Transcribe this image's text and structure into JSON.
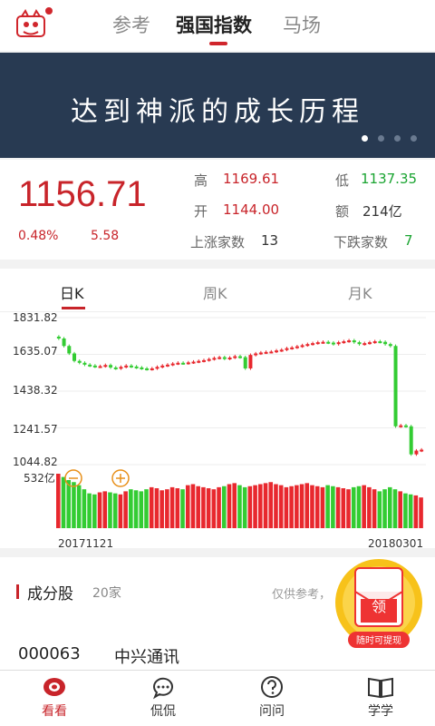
{
  "topnav": {
    "tabs": [
      {
        "label": "参考"
      },
      {
        "label": "强国指数"
      },
      {
        "label": "马场"
      }
    ],
    "active": "强国指数"
  },
  "banner": {
    "text": "达到神派的成长历程",
    "pages": 4,
    "current": 1
  },
  "quote": {
    "price": "1156.71",
    "change_pct": "0.48%",
    "change_abs": "5.58",
    "high_label": "高",
    "high": "1169.61",
    "low_label": "低",
    "low": "1137.35",
    "open_label": "开",
    "open": "1144.00",
    "amount_label": "额",
    "amount": "214亿",
    "up_label": "上涨家数",
    "up": "13",
    "down_label": "下跌家数",
    "down": "7"
  },
  "kline_tabs": [
    {
      "label": "日K"
    },
    {
      "label": "周K"
    },
    {
      "label": "月K"
    }
  ],
  "chart": {
    "y_ticks": [
      "1831.82",
      "1635.07",
      "1438.32",
      "1241.57",
      "1044.82"
    ],
    "volume_label": "532亿",
    "start_date": "20171121",
    "end_date": "20180301",
    "colors": {
      "up": "#e8282e",
      "down": "#33cc33"
    }
  },
  "chart_data": {
    "type": "candlestick",
    "y_ticks": [
      1831.82,
      1635.07,
      1438.32,
      1241.57,
      1044.82
    ],
    "ylim": [
      1044.82,
      1831.82
    ],
    "x_range": [
      "20171121",
      "20180301"
    ],
    "close": [
      1720,
      1680,
      1640,
      1600,
      1590,
      1580,
      1575,
      1570,
      1572,
      1578,
      1565,
      1560,
      1568,
      1575,
      1570,
      1565,
      1560,
      1556,
      1560,
      1568,
      1575,
      1580,
      1586,
      1590,
      1588,
      1592,
      1596,
      1600,
      1604,
      1610,
      1616,
      1620,
      1612,
      1618,
      1625,
      1620,
      1560,
      1632,
      1640,
      1645,
      1648,
      1650,
      1656,
      1660,
      1668,
      1672,
      1678,
      1684,
      1690,
      1695,
      1700,
      1702,
      1698,
      1690,
      1700,
      1705,
      1710,
      1700,
      1690,
      1695,
      1700,
      1705,
      1702,
      1690,
      1680,
      1250,
      1255,
      1250,
      1100,
      1120,
      1125
    ],
    "volume_unit": "亿",
    "volume_max": 532,
    "volume": [
      532,
      500,
      470,
      450,
      420,
      380,
      340,
      330,
      350,
      360,
      350,
      340,
      330,
      360,
      380,
      370,
      360,
      380,
      400,
      390,
      370,
      380,
      400,
      390,
      380,
      420,
      430,
      410,
      400,
      390,
      380,
      400,
      410,
      430,
      440,
      420,
      400,
      410,
      420,
      430,
      440,
      450,
      430,
      420,
      400,
      410,
      420,
      430,
      440,
      420,
      410,
      400,
      420,
      410,
      400,
      390,
      380,
      400,
      410,
      420,
      400,
      380,
      360,
      380,
      400,
      380,
      360,
      340,
      330,
      320,
      300
    ]
  },
  "section": {
    "title": "成分股",
    "count": "20家",
    "note": "仅供参考，",
    "first_code": "000063",
    "first_name": "中兴通讯"
  },
  "promo": {
    "main": "领",
    "sub": "随时可提现"
  },
  "bottomnav": [
    {
      "label": "看看",
      "icon": "eye-icon"
    },
    {
      "label": "侃侃",
      "icon": "chat-icon"
    },
    {
      "label": "问问",
      "icon": "question-icon"
    },
    {
      "label": "学学",
      "icon": "book-icon"
    }
  ]
}
